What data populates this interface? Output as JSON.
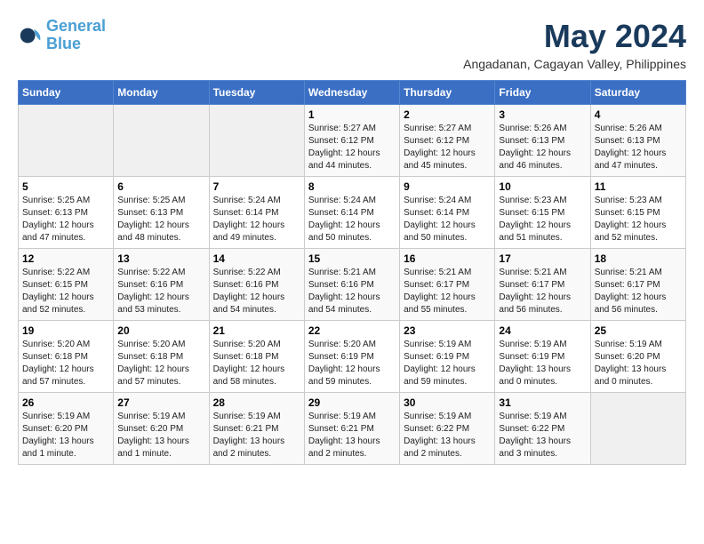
{
  "logo": {
    "line1": "General",
    "line2": "Blue"
  },
  "title": "May 2024",
  "subtitle": "Angadanan, Cagayan Valley, Philippines",
  "weekdays": [
    "Sunday",
    "Monday",
    "Tuesday",
    "Wednesday",
    "Thursday",
    "Friday",
    "Saturday"
  ],
  "weeks": [
    [
      {
        "day": "",
        "info": ""
      },
      {
        "day": "",
        "info": ""
      },
      {
        "day": "",
        "info": ""
      },
      {
        "day": "1",
        "info": "Sunrise: 5:27 AM\nSunset: 6:12 PM\nDaylight: 12 hours\nand 44 minutes."
      },
      {
        "day": "2",
        "info": "Sunrise: 5:27 AM\nSunset: 6:12 PM\nDaylight: 12 hours\nand 45 minutes."
      },
      {
        "day": "3",
        "info": "Sunrise: 5:26 AM\nSunset: 6:13 PM\nDaylight: 12 hours\nand 46 minutes."
      },
      {
        "day": "4",
        "info": "Sunrise: 5:26 AM\nSunset: 6:13 PM\nDaylight: 12 hours\nand 47 minutes."
      }
    ],
    [
      {
        "day": "5",
        "info": "Sunrise: 5:25 AM\nSunset: 6:13 PM\nDaylight: 12 hours\nand 47 minutes."
      },
      {
        "day": "6",
        "info": "Sunrise: 5:25 AM\nSunset: 6:13 PM\nDaylight: 12 hours\nand 48 minutes."
      },
      {
        "day": "7",
        "info": "Sunrise: 5:24 AM\nSunset: 6:14 PM\nDaylight: 12 hours\nand 49 minutes."
      },
      {
        "day": "8",
        "info": "Sunrise: 5:24 AM\nSunset: 6:14 PM\nDaylight: 12 hours\nand 50 minutes."
      },
      {
        "day": "9",
        "info": "Sunrise: 5:24 AM\nSunset: 6:14 PM\nDaylight: 12 hours\nand 50 minutes."
      },
      {
        "day": "10",
        "info": "Sunrise: 5:23 AM\nSunset: 6:15 PM\nDaylight: 12 hours\nand 51 minutes."
      },
      {
        "day": "11",
        "info": "Sunrise: 5:23 AM\nSunset: 6:15 PM\nDaylight: 12 hours\nand 52 minutes."
      }
    ],
    [
      {
        "day": "12",
        "info": "Sunrise: 5:22 AM\nSunset: 6:15 PM\nDaylight: 12 hours\nand 52 minutes."
      },
      {
        "day": "13",
        "info": "Sunrise: 5:22 AM\nSunset: 6:16 PM\nDaylight: 12 hours\nand 53 minutes."
      },
      {
        "day": "14",
        "info": "Sunrise: 5:22 AM\nSunset: 6:16 PM\nDaylight: 12 hours\nand 54 minutes."
      },
      {
        "day": "15",
        "info": "Sunrise: 5:21 AM\nSunset: 6:16 PM\nDaylight: 12 hours\nand 54 minutes."
      },
      {
        "day": "16",
        "info": "Sunrise: 5:21 AM\nSunset: 6:17 PM\nDaylight: 12 hours\nand 55 minutes."
      },
      {
        "day": "17",
        "info": "Sunrise: 5:21 AM\nSunset: 6:17 PM\nDaylight: 12 hours\nand 56 minutes."
      },
      {
        "day": "18",
        "info": "Sunrise: 5:21 AM\nSunset: 6:17 PM\nDaylight: 12 hours\nand 56 minutes."
      }
    ],
    [
      {
        "day": "19",
        "info": "Sunrise: 5:20 AM\nSunset: 6:18 PM\nDaylight: 12 hours\nand 57 minutes."
      },
      {
        "day": "20",
        "info": "Sunrise: 5:20 AM\nSunset: 6:18 PM\nDaylight: 12 hours\nand 57 minutes."
      },
      {
        "day": "21",
        "info": "Sunrise: 5:20 AM\nSunset: 6:18 PM\nDaylight: 12 hours\nand 58 minutes."
      },
      {
        "day": "22",
        "info": "Sunrise: 5:20 AM\nSunset: 6:19 PM\nDaylight: 12 hours\nand 59 minutes."
      },
      {
        "day": "23",
        "info": "Sunrise: 5:19 AM\nSunset: 6:19 PM\nDaylight: 12 hours\nand 59 minutes."
      },
      {
        "day": "24",
        "info": "Sunrise: 5:19 AM\nSunset: 6:19 PM\nDaylight: 13 hours\nand 0 minutes."
      },
      {
        "day": "25",
        "info": "Sunrise: 5:19 AM\nSunset: 6:20 PM\nDaylight: 13 hours\nand 0 minutes."
      }
    ],
    [
      {
        "day": "26",
        "info": "Sunrise: 5:19 AM\nSunset: 6:20 PM\nDaylight: 13 hours\nand 1 minute."
      },
      {
        "day": "27",
        "info": "Sunrise: 5:19 AM\nSunset: 6:20 PM\nDaylight: 13 hours\nand 1 minute."
      },
      {
        "day": "28",
        "info": "Sunrise: 5:19 AM\nSunset: 6:21 PM\nDaylight: 13 hours\nand 2 minutes."
      },
      {
        "day": "29",
        "info": "Sunrise: 5:19 AM\nSunset: 6:21 PM\nDaylight: 13 hours\nand 2 minutes."
      },
      {
        "day": "30",
        "info": "Sunrise: 5:19 AM\nSunset: 6:22 PM\nDaylight: 13 hours\nand 2 minutes."
      },
      {
        "day": "31",
        "info": "Sunrise: 5:19 AM\nSunset: 6:22 PM\nDaylight: 13 hours\nand 3 minutes."
      },
      {
        "day": "",
        "info": ""
      }
    ]
  ]
}
